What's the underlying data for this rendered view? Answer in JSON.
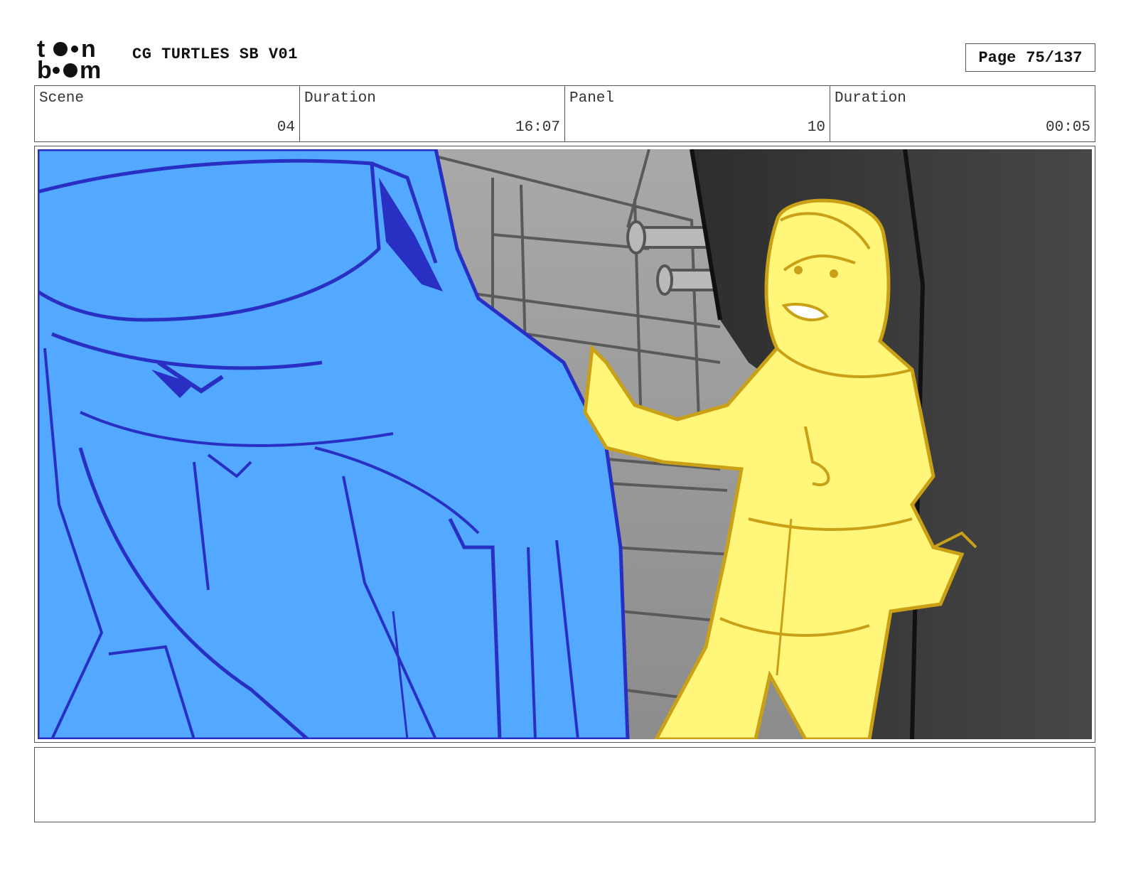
{
  "header": {
    "logo": {
      "text_top": "toon",
      "text_bottom": "boom"
    },
    "project_title": "CG TURTLES SB V01",
    "page_label": "Page",
    "page_number": "75/137"
  },
  "info": {
    "scene_label": "Scene",
    "scene_value": "04",
    "scene_duration_label": "Duration",
    "scene_duration_value": "16:07",
    "panel_label": "Panel",
    "panel_value": "10",
    "panel_duration_label": "Duration",
    "panel_duration_value": "00:05"
  },
  "colors": {
    "turtle_fill": "#53a9ff",
    "turtle_line": "#2a2fc4",
    "girl_fill": "#fff67a",
    "girl_line": "#c9a016",
    "background_gray": "#9a9a9a",
    "doorway_dark": "#3a3a3a"
  },
  "notes": {
    "text": ""
  }
}
